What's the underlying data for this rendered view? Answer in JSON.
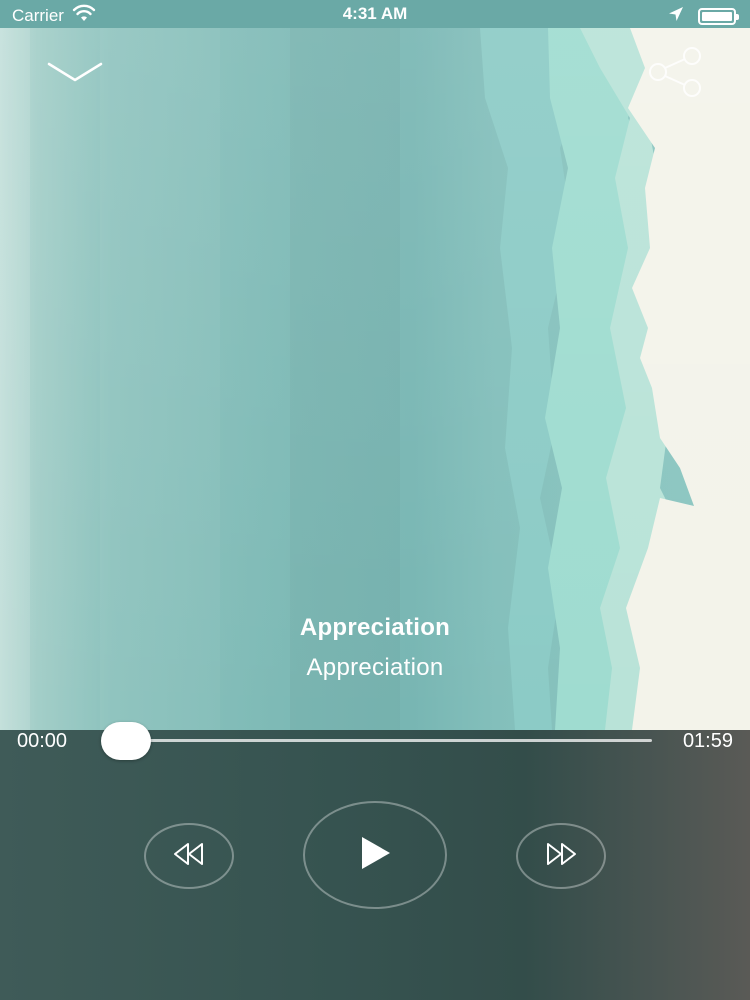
{
  "status_bar": {
    "carrier": "Carrier",
    "time": "4:31 AM",
    "icons": [
      "wifi-icon",
      "location-arrow-icon",
      "battery-icon"
    ]
  },
  "header": {
    "collapse_icon": "chevron-down-icon",
    "share_icon": "share-icon"
  },
  "track": {
    "title": "Appreciation",
    "artist": "Appreciation"
  },
  "progress": {
    "current": "00:00",
    "total": "01:59",
    "fraction": 0
  },
  "controls": {
    "rewind_icon": "rewind-icon",
    "play_icon": "play-icon",
    "forward_icon": "fast-forward-icon"
  },
  "colors": {
    "status_bar": "#6aa9a6",
    "artwork_teal": "#7cbdb9",
    "artwork_cream": "#f3f3ea",
    "player_bg": "#365350"
  }
}
